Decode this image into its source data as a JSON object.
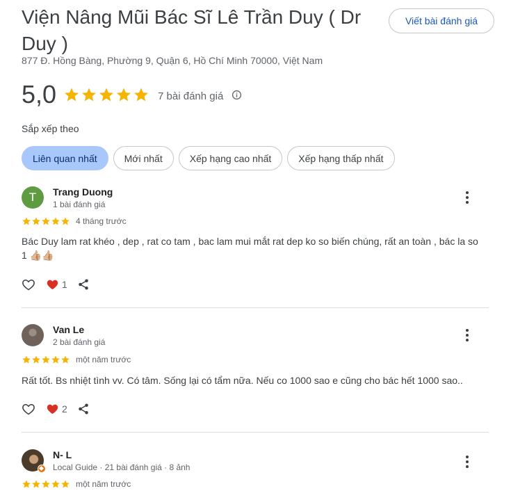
{
  "place": {
    "title": "Viện Nâng Mũi Bác Sĩ Lê Trần Duy ( Dr Duy )",
    "address": "877 Đ. Hồng Bàng, Phường 9, Quận 6, Hồ Chí Minh 70000, Việt Nam",
    "write_review_label": "Viết bài đánh giá"
  },
  "rating": {
    "score": "5,0",
    "stars": 5,
    "review_count": "7 bài đánh giá",
    "info_icon": "info-icon"
  },
  "sort": {
    "label": "Sắp xếp theo",
    "options": [
      "Liên quan nhất",
      "Mới nhất",
      "Xếp hạng cao nhất",
      "Xếp hạng thấp nhất"
    ],
    "selected": "Liên quan nhất"
  },
  "reviews": [
    {
      "avatar_letter": "T",
      "name": "Trang Duong",
      "meta": "1 bài đánh giá",
      "stars": 5,
      "time": "4 tháng trước",
      "text": "Bác Duy lam rat khéo , dep , rat co tam , bac lam mui mắt rat dep ko so biến chúng, rất an toàn , bác la so 1",
      "emoji": "👍🏼👍🏼",
      "reaction_count": "1"
    },
    {
      "avatar_letter": "",
      "name": "Van Le",
      "meta": "2 bài đánh giá",
      "stars": 5,
      "time": "một năm trước",
      "text": "Rất tốt. Bs nhiệt tình vv. Có tâm. Sống lại có tẩm nữa. Nếu co 1000 sao e cũng cho bác hết 1000 sao..",
      "emoji": "",
      "reaction_count": "2"
    },
    {
      "avatar_letter": "",
      "name": "N- L",
      "meta": "Local Guide · 21 bài đánh giá · 8 ảnh",
      "stars": 5,
      "time": "một năm trước",
      "text": "",
      "emoji": "",
      "reaction_count": ""
    }
  ],
  "colors": {
    "star": "#f4b400",
    "heart": "#d93025",
    "accent": "#1a57b5",
    "chip_active": "#a8c7fa"
  }
}
